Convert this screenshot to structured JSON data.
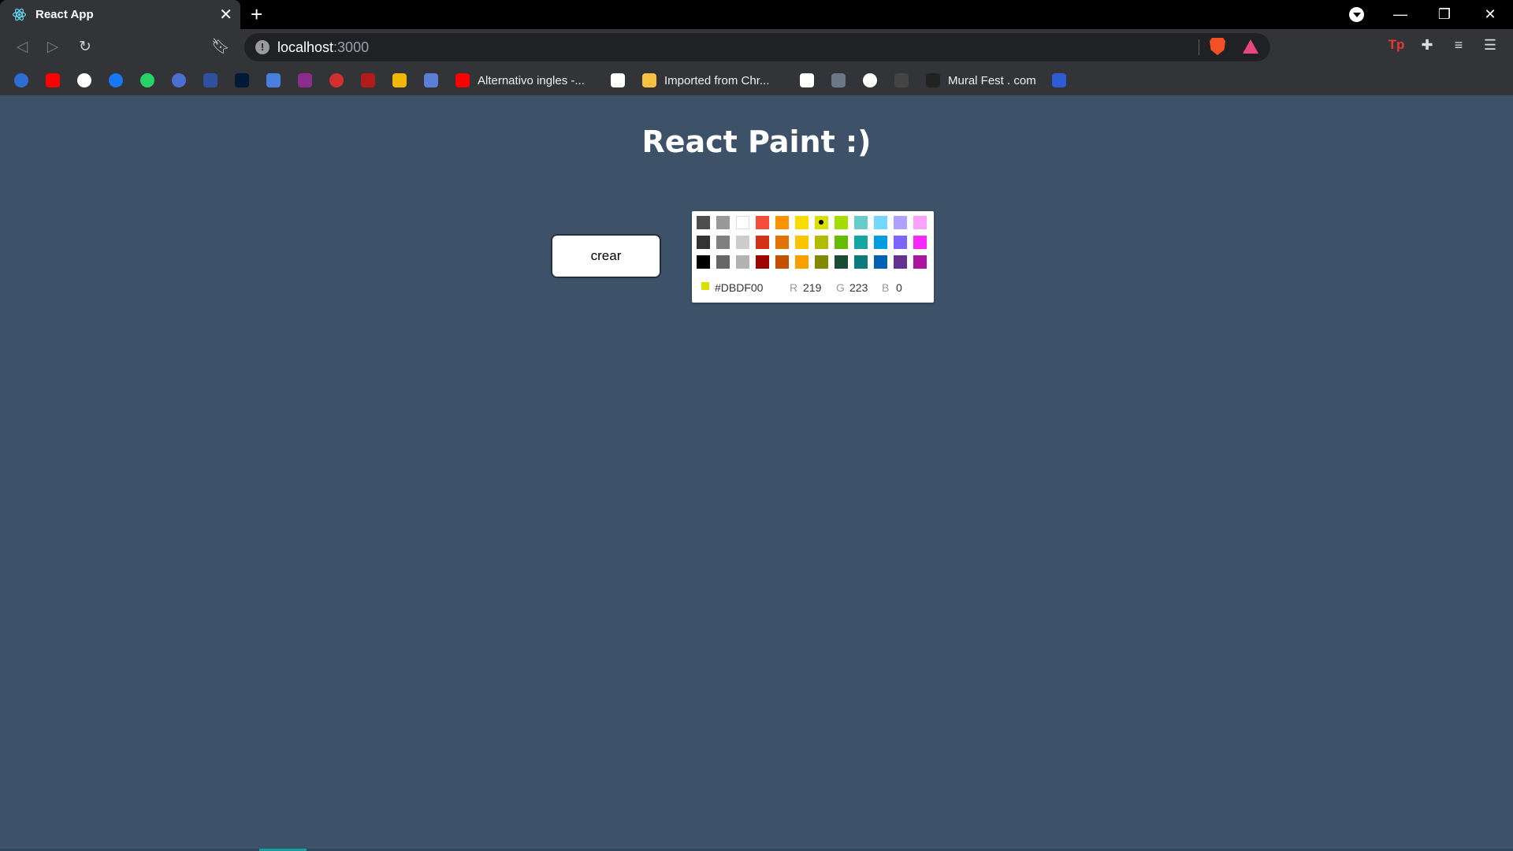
{
  "browser": {
    "tab_title": "React App",
    "url_host": "localhost",
    "url_port": ":3000",
    "bookmarks": [
      {
        "icon": "copyleaks-icon",
        "color": "#2b6fd6",
        "label": ""
      },
      {
        "icon": "youtube-icon",
        "color": "#ff0000",
        "label": ""
      },
      {
        "icon": "google-icon",
        "color": "#ffffff",
        "label": ""
      },
      {
        "icon": "facebook-icon",
        "color": "#1877f2",
        "label": ""
      },
      {
        "icon": "whatsapp-icon",
        "color": "#25d366",
        "label": ""
      },
      {
        "icon": "messenger-icon",
        "color": "#4a6fd1",
        "label": ""
      },
      {
        "icon": "myanimelist-icon",
        "color": "#2e51a2",
        "label": ""
      },
      {
        "icon": "tumblr-icon",
        "color": "#001935",
        "label": ""
      },
      {
        "icon": "translate-icon",
        "color": "#4a7fe0",
        "label": ""
      },
      {
        "icon": "game-icon",
        "color": "#8b2d8b",
        "label": ""
      },
      {
        "icon": "target-icon",
        "color": "#d32f2f",
        "label": ""
      },
      {
        "icon": "shield-icon",
        "color": "#b31b1b",
        "label": ""
      },
      {
        "icon": "bars-icon",
        "color": "#f2b705",
        "label": ""
      },
      {
        "icon": "calendar-icon",
        "color": "#5a7fd6",
        "label": ""
      },
      {
        "icon": "youtube-icon",
        "color": "#ff0000",
        "label": "Alternativo ingles -..."
      },
      {
        "icon": "cat-icon",
        "color": "#ffffff",
        "label": ""
      },
      {
        "icon": "folder-icon",
        "color": "#f5c242",
        "label": "Imported from Chr..."
      },
      {
        "icon": "reader-icon",
        "color": "#ffffff",
        "label": ""
      },
      {
        "icon": "art-icon",
        "color": "#6b7687",
        "label": ""
      },
      {
        "icon": "globe-icon",
        "color": "#ffffff",
        "label": ""
      },
      {
        "icon": "m-icon",
        "color": "#444444",
        "label": ""
      },
      {
        "icon": "mural-icon",
        "color": "#222222",
        "label": "Mural Fest . com"
      },
      {
        "icon": "bolt-icon",
        "color": "#2f5bd6",
        "label": ""
      }
    ]
  },
  "app": {
    "title": "React Paint :)",
    "button_label": "crear"
  },
  "picker": {
    "swatches": [
      [
        "#4D4D4D",
        "#999999",
        "#FFFFFF",
        "#F44E3B",
        "#FE9200",
        "#FCDC00",
        "#DBDF00",
        "#A4DD00",
        "#68CCCA",
        "#73D8FF",
        "#AEA1FF",
        "#FDA1FF"
      ],
      [
        "#333333",
        "#808080",
        "#CCCCCC",
        "#D33115",
        "#E27300",
        "#FCC400",
        "#B0BC00",
        "#68BC00",
        "#16A5A5",
        "#009CE0",
        "#7B64FF",
        "#FA28FF"
      ],
      [
        "#000000",
        "#666666",
        "#B3B3B3",
        "#9F0500",
        "#C45100",
        "#FB9E00",
        "#808900",
        "#194D33",
        "#0C797D",
        "#0062B1",
        "#653294",
        "#AB149E"
      ]
    ],
    "selected": "#DBDF00",
    "hex": "#DBDF00",
    "r_label": "R",
    "r": "219",
    "g_label": "G",
    "g": "223",
    "b_label": "B",
    "b": "0"
  }
}
